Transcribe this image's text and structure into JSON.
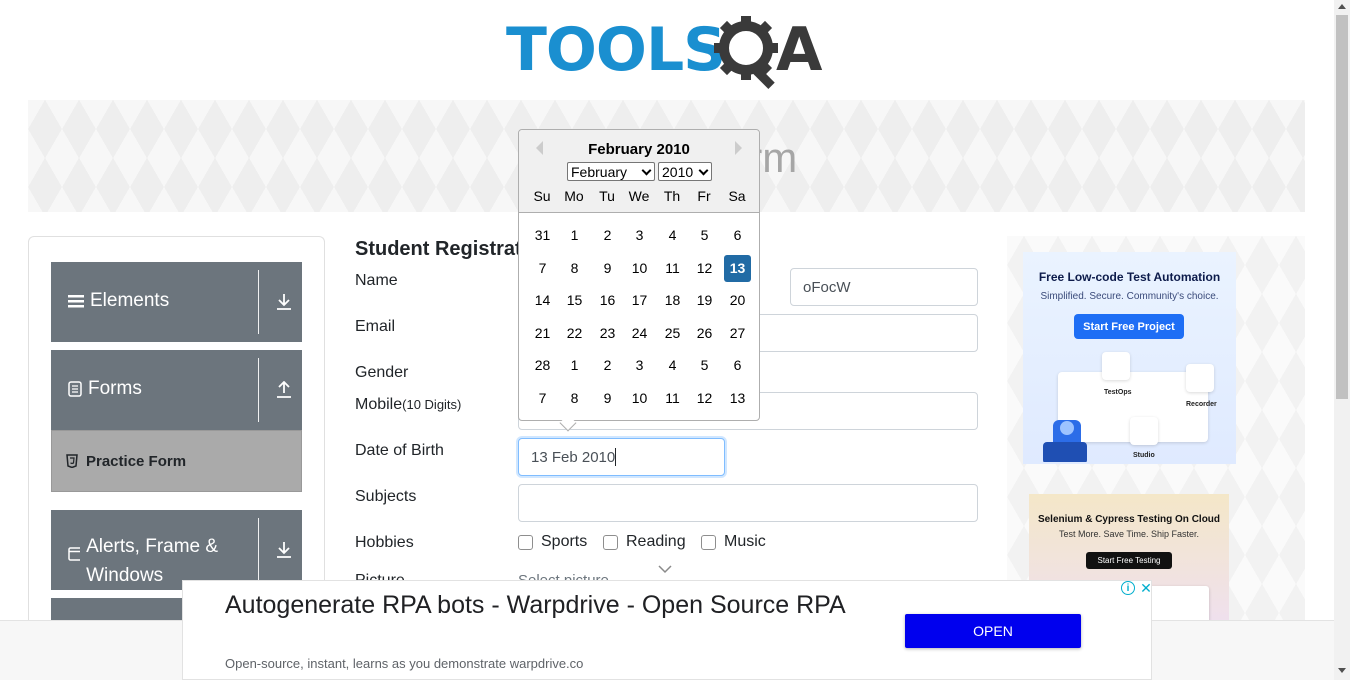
{
  "brand": {
    "logo_text": "TOOLS",
    "logo_tail": "A"
  },
  "banner": {
    "title": "Practice Form"
  },
  "sidebar": {
    "groups": [
      {
        "label": "Elements",
        "icon": "hamburger-icon",
        "arrow": "download-arrow-icon"
      },
      {
        "label": "Forms",
        "icon": "document-icon",
        "arrow": "upload-arrow-icon"
      },
      {
        "label": "Alerts, Frame & Windows",
        "icon": "window-icon",
        "arrow": "download-arrow-icon"
      }
    ],
    "active_item": {
      "label": "Practice Form",
      "icon": "html-icon"
    }
  },
  "form": {
    "title": "Student Registration Form",
    "name_label": "Name",
    "last_name_value": "oFocW",
    "email_label": "Email",
    "gender_label": "Gender",
    "mobile_label": "Mobile",
    "mobile_hint": "(10 Digits)",
    "dob_label": "Date of Birth",
    "dob_value": "13 Feb 2010",
    "subjects_label": "Subjects",
    "hobbies_label": "Hobbies",
    "hobbies": [
      "Sports",
      "Reading",
      "Music"
    ],
    "picture_label": "Picture",
    "select_placeholder": "Select picture"
  },
  "datepicker": {
    "current_month": "February 2010",
    "month_select": "February",
    "year_select": "2010",
    "weekdays": [
      "Su",
      "Mo",
      "Tu",
      "We",
      "Th",
      "Fr",
      "Sa"
    ],
    "weeks": [
      [
        "31",
        "1",
        "2",
        "3",
        "4",
        "5",
        "6"
      ],
      [
        "7",
        "8",
        "9",
        "10",
        "11",
        "12",
        "13"
      ],
      [
        "14",
        "15",
        "16",
        "17",
        "18",
        "19",
        "20"
      ],
      [
        "21",
        "22",
        "23",
        "24",
        "25",
        "26",
        "27"
      ],
      [
        "28",
        "1",
        "2",
        "3",
        "4",
        "5",
        "6"
      ],
      [
        "7",
        "8",
        "9",
        "10",
        "11",
        "12",
        "13"
      ]
    ],
    "selected_day": "13",
    "selected_color": "#216ba5"
  },
  "ads": {
    "ad1": {
      "title": "Free Low-code Test Automation",
      "subtitle": "Simplified. Secure. Community's choice.",
      "button": "Start Free Project",
      "labels": [
        "TestOps",
        "Recorder",
        "Studio"
      ]
    },
    "ad2": {
      "title": "Selenium & Cypress Testing On Cloud",
      "subtitle": "Test More. Save Time. Ship Faster.",
      "button": "Start Free Testing"
    },
    "bottom": {
      "headline": "Autogenerate RPA bots - Warpdrive - Open Source RPA",
      "sub": "Open-source, instant, learns as you demonstrate warpdrive.co",
      "button": "OPEN"
    }
  },
  "colors": {
    "brand_blue": "#1a8fd0",
    "nav_gray": "#6c757d",
    "ad_button_blue": "#0000ee"
  }
}
